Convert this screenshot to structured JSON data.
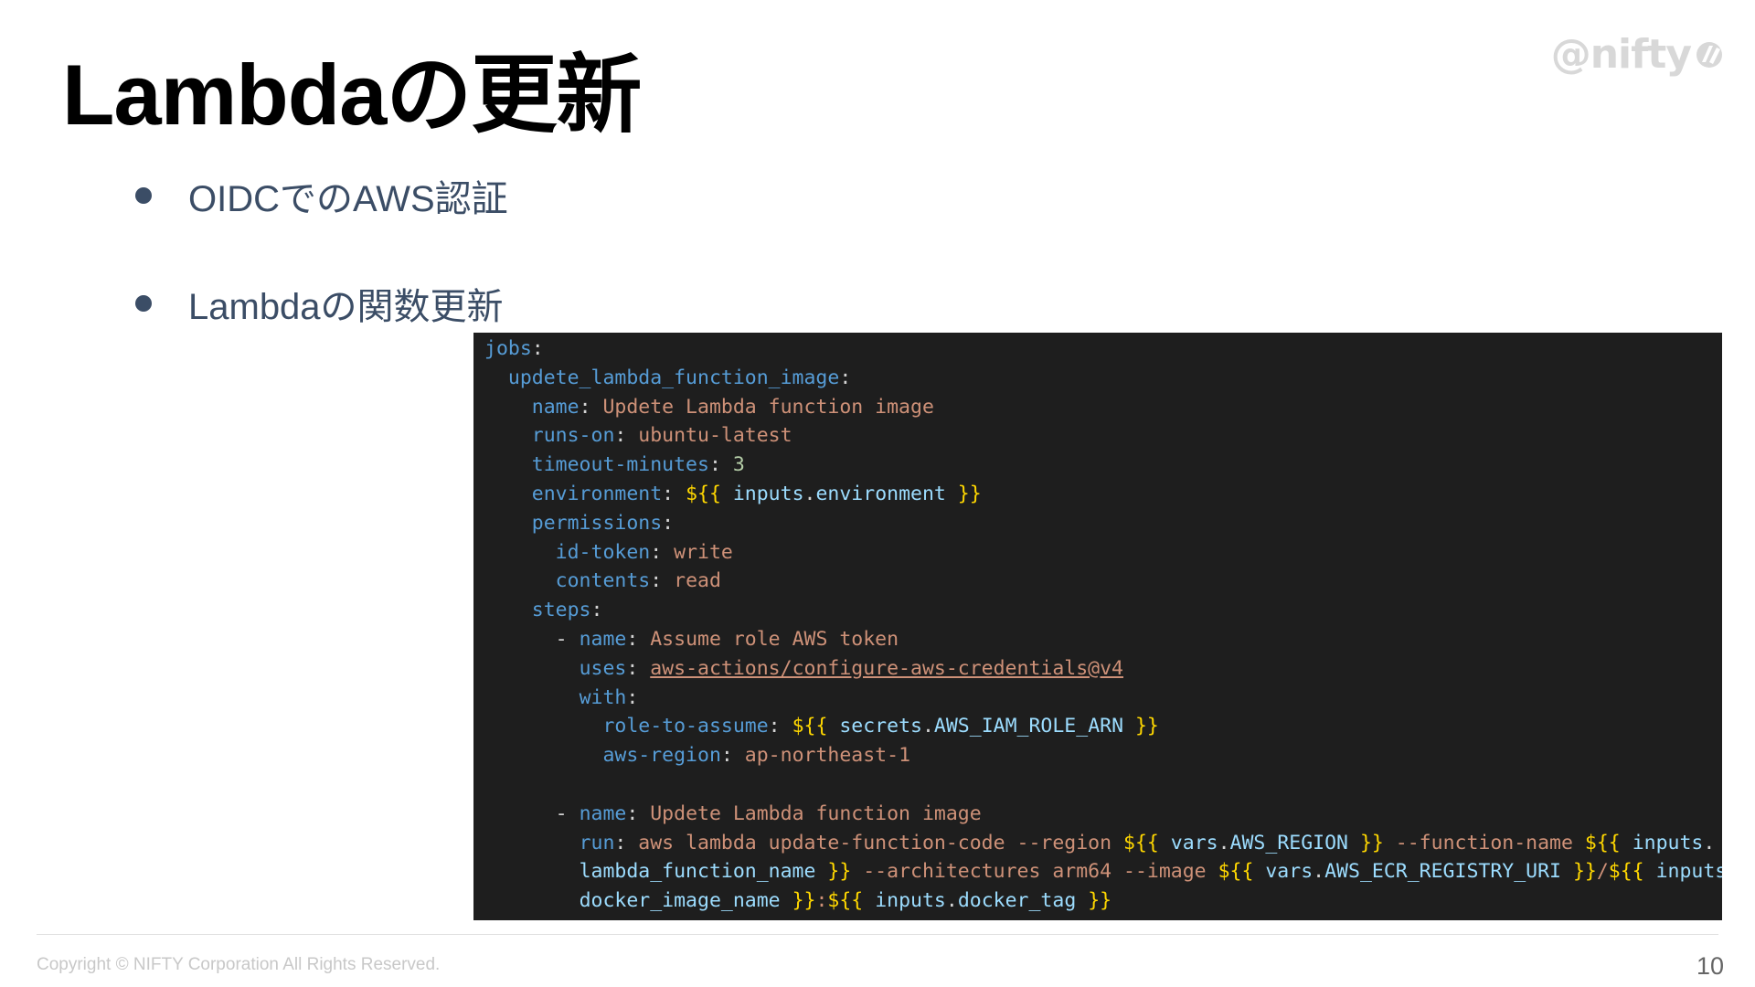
{
  "slide": {
    "title": "Lambdaの更新",
    "logo": {
      "text": "@nifty",
      "icon": "nifty-logo-icon"
    },
    "bullets": [
      "OIDCでのAWS認証",
      "Lambdaの関数更新"
    ],
    "footer": {
      "copyright": "Copyright © NIFTY Corporation All Rights Reserved.",
      "page_number": "10"
    }
  },
  "code": {
    "theme": {
      "background": "#1e1e1e",
      "key": "#569cd6",
      "string": "#ce9178",
      "expression": "#ffd700"
    },
    "lines": [
      [
        {
          "t": "jobs",
          "c": "k"
        },
        {
          "t": ":",
          "c": "p"
        }
      ],
      [
        {
          "t": "  "
        },
        {
          "t": "updete_lambda_function_image",
          "c": "k"
        },
        {
          "t": ":",
          "c": "p"
        }
      ],
      [
        {
          "t": "    "
        },
        {
          "t": "name",
          "c": "k"
        },
        {
          "t": ": ",
          "c": "p"
        },
        {
          "t": "Updete Lambda function image",
          "c": "s"
        }
      ],
      [
        {
          "t": "    "
        },
        {
          "t": "runs-on",
          "c": "k"
        },
        {
          "t": ": ",
          "c": "p"
        },
        {
          "t": "ubuntu-latest",
          "c": "s"
        }
      ],
      [
        {
          "t": "    "
        },
        {
          "t": "timeout-minutes",
          "c": "k"
        },
        {
          "t": ": ",
          "c": "p"
        },
        {
          "t": "3",
          "c": "n"
        }
      ],
      [
        {
          "t": "    "
        },
        {
          "t": "environment",
          "c": "k"
        },
        {
          "t": ": ",
          "c": "p"
        },
        {
          "t": "${{",
          "c": "b"
        },
        {
          "t": " inputs",
          "c": "v"
        },
        {
          "t": ".",
          "c": "p"
        },
        {
          "t": "environment",
          "c": "v"
        },
        {
          "t": " }}",
          "c": "b"
        }
      ],
      [
        {
          "t": "    "
        },
        {
          "t": "permissions",
          "c": "k"
        },
        {
          "t": ":",
          "c": "p"
        }
      ],
      [
        {
          "t": "      "
        },
        {
          "t": "id-token",
          "c": "k"
        },
        {
          "t": ": ",
          "c": "p"
        },
        {
          "t": "write",
          "c": "s"
        }
      ],
      [
        {
          "t": "      "
        },
        {
          "t": "contents",
          "c": "k"
        },
        {
          "t": ": ",
          "c": "p"
        },
        {
          "t": "read",
          "c": "s"
        }
      ],
      [
        {
          "t": "    "
        },
        {
          "t": "steps",
          "c": "k"
        },
        {
          "t": ":",
          "c": "p"
        }
      ],
      [
        {
          "t": "      - ",
          "c": "p"
        },
        {
          "t": "name",
          "c": "k"
        },
        {
          "t": ": ",
          "c": "p"
        },
        {
          "t": "Assume role AWS token",
          "c": "s"
        }
      ],
      [
        {
          "t": "        "
        },
        {
          "t": "uses",
          "c": "k"
        },
        {
          "t": ": ",
          "c": "p"
        },
        {
          "t": "aws-actions/configure-aws-credentials@v4",
          "c": "s u"
        }
      ],
      [
        {
          "t": "        "
        },
        {
          "t": "with",
          "c": "k"
        },
        {
          "t": ":",
          "c": "p"
        }
      ],
      [
        {
          "t": "          "
        },
        {
          "t": "role-to-assume",
          "c": "k"
        },
        {
          "t": ": ",
          "c": "p"
        },
        {
          "t": "${{",
          "c": "b"
        },
        {
          "t": " secrets",
          "c": "v"
        },
        {
          "t": ".",
          "c": "p"
        },
        {
          "t": "AWS_IAM_ROLE_ARN",
          "c": "v"
        },
        {
          "t": " }}",
          "c": "b"
        }
      ],
      [
        {
          "t": "          "
        },
        {
          "t": "aws-region",
          "c": "k"
        },
        {
          "t": ": ",
          "c": "p"
        },
        {
          "t": "ap-northeast-1",
          "c": "s"
        }
      ],
      [],
      [
        {
          "t": "      - ",
          "c": "p"
        },
        {
          "t": "name",
          "c": "k"
        },
        {
          "t": ": ",
          "c": "p"
        },
        {
          "t": "Updete Lambda function image",
          "c": "s"
        }
      ],
      [
        {
          "t": "        "
        },
        {
          "t": "run",
          "c": "k"
        },
        {
          "t": ": ",
          "c": "p"
        },
        {
          "t": "aws lambda update-function-code --region ",
          "c": "s"
        },
        {
          "t": "${{",
          "c": "b"
        },
        {
          "t": " vars",
          "c": "v"
        },
        {
          "t": ".",
          "c": "p"
        },
        {
          "t": "AWS_REGION",
          "c": "v"
        },
        {
          "t": " }}",
          "c": "b"
        },
        {
          "t": " --function-name ",
          "c": "s"
        },
        {
          "t": "${{",
          "c": "b"
        },
        {
          "t": " inputs",
          "c": "v"
        },
        {
          "t": ".",
          "c": "p"
        }
      ],
      [
        {
          "t": "        "
        },
        {
          "t": "lambda_function_name",
          "c": "v"
        },
        {
          "t": " }}",
          "c": "b"
        },
        {
          "t": " --architectures arm64 --image ",
          "c": "s"
        },
        {
          "t": "${{",
          "c": "b"
        },
        {
          "t": " vars",
          "c": "v"
        },
        {
          "t": ".",
          "c": "p"
        },
        {
          "t": "AWS_ECR_REGISTRY_URI",
          "c": "v"
        },
        {
          "t": " }}",
          "c": "b"
        },
        {
          "t": "/",
          "c": "s"
        },
        {
          "t": "${{",
          "c": "b"
        },
        {
          "t": " inputs",
          "c": "v"
        },
        {
          "t": ".",
          "c": "p"
        }
      ],
      [
        {
          "t": "        "
        },
        {
          "t": "docker_image_name",
          "c": "v"
        },
        {
          "t": " }}",
          "c": "b"
        },
        {
          "t": ":",
          "c": "s"
        },
        {
          "t": "${{",
          "c": "b"
        },
        {
          "t": " inputs",
          "c": "v"
        },
        {
          "t": ".",
          "c": "p"
        },
        {
          "t": "docker_tag",
          "c": "v"
        },
        {
          "t": " }}",
          "c": "b"
        }
      ]
    ]
  }
}
